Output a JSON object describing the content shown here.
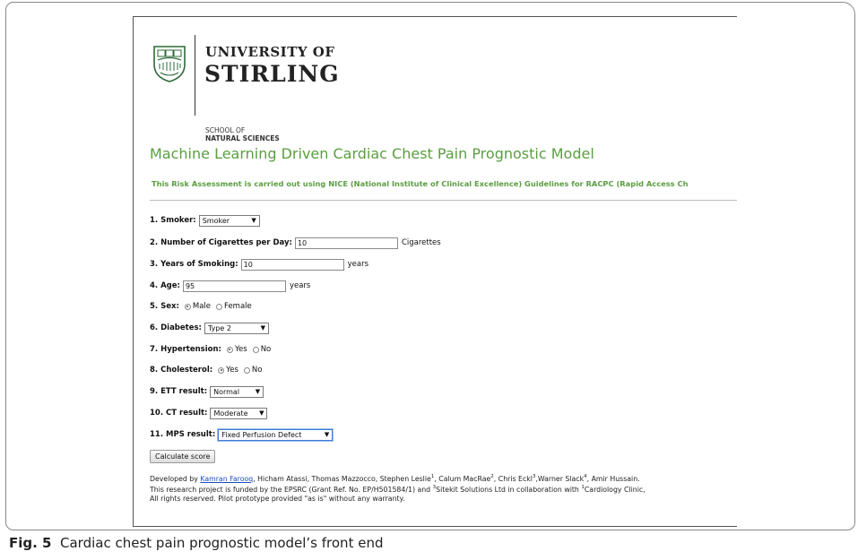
{
  "header": {
    "university_line1": "UNIVERSITY OF",
    "university_line2": "STIRLING",
    "school_line1": "SCHOOL OF",
    "school_line2": "NATURAL SCIENCES"
  },
  "app": {
    "title": "Machine Learning Driven Cardiac Chest Pain Prognostic Model",
    "subtitle": "This Risk Assessment is carried out using NICE (National Institute of Clinical Excellence) Guidelines for RACPC (Rapid Access Ch"
  },
  "form": {
    "smoker": {
      "label": "1. Smoker:",
      "value": "Smoker"
    },
    "cigarettes": {
      "label": "2. Number of Cigarettes per Day:",
      "value": "10",
      "unit": "Cigarettes"
    },
    "years_smoking": {
      "label": "3. Years of Smoking:",
      "value": "10",
      "unit": "years"
    },
    "age": {
      "label": "4. Age:",
      "value": "95",
      "unit": "years"
    },
    "sex": {
      "label": "5. Sex:",
      "options": [
        "Male",
        "Female"
      ],
      "selected": "Male"
    },
    "diabetes": {
      "label": "6. Diabetes:",
      "value": "Type 2"
    },
    "hypertension": {
      "label": "7. Hypertension:",
      "options": [
        "Yes",
        "No"
      ],
      "selected": "Yes"
    },
    "cholesterol": {
      "label": "8. Cholesterol:",
      "options": [
        "Yes",
        "No"
      ],
      "selected": "Yes"
    },
    "ett": {
      "label": "9. ETT result:",
      "value": "Normal"
    },
    "ct": {
      "label": "10. CT result:",
      "value": "Moderate"
    },
    "mps": {
      "label": "11. MPS result:",
      "value": "Fixed Perfusion Defect"
    },
    "submit_label": "Calculate score"
  },
  "footer": {
    "developed_prefix": "Developed by ",
    "developer_link": "Kamran Farooq",
    "developed_rest": ", Hicham Atassi, Thomas Mazzocco, Stephen Leslie",
    "sup1": "1",
    "calum": ", Calum MacRae",
    "sup2": "2",
    "chris": ", Chris Eckl",
    "sup3": "3",
    "warner": ",Warner Slack",
    "sup4": "4",
    "amir": ", Amir Hussain.",
    "funding_prefix": "This research project is funded by the EPSRC (Grant Ref. No. EP/H501584/1) and ",
    "sitekit_sup": "3",
    "funding_mid": "Sitekit Solutions Ltd in collaboration with ",
    "clinic_sup": "1",
    "funding_end": "Cardiology Clinic,",
    "rights": "All rights reserved. Pilot prototype provided \"as is\" without any warranty."
  },
  "caption": {
    "label": "Fig. 5",
    "text": "  Cardiac chest pain prognostic model’s front end"
  }
}
